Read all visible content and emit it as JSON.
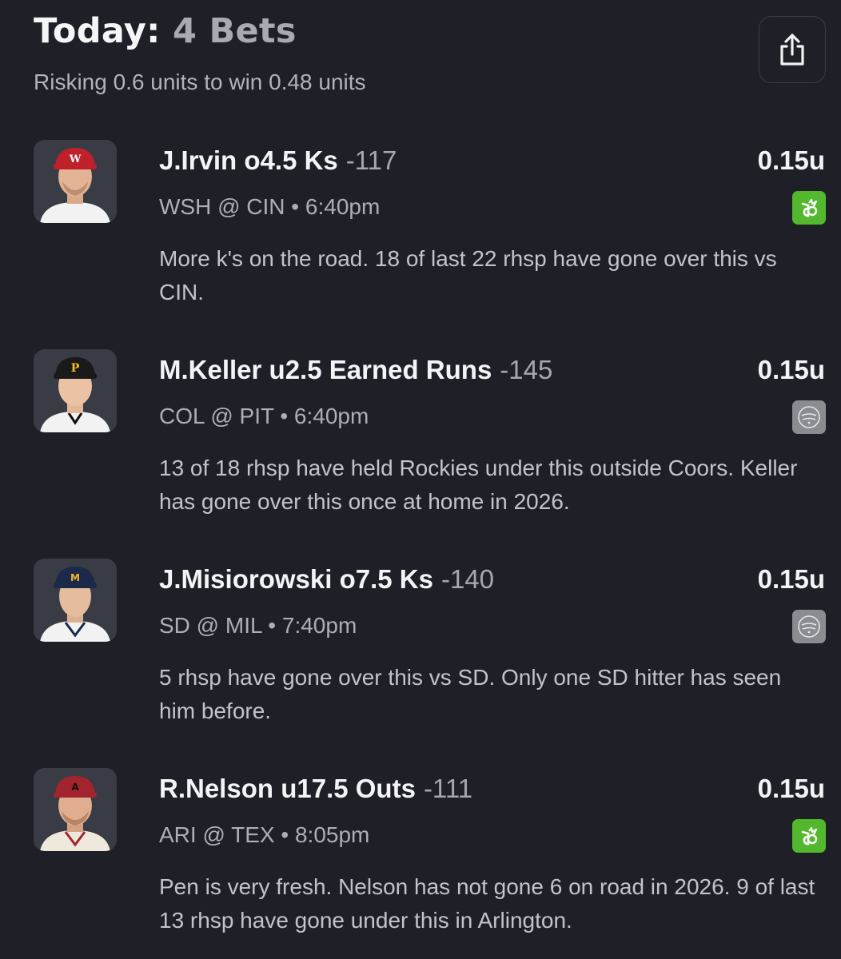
{
  "header": {
    "title_prefix": "Today:",
    "title_count": "4 Bets",
    "subtitle": "Risking 0.6 units to win 0.48 units",
    "share_icon": "share-icon"
  },
  "bets": [
    {
      "player": "J.Irvin",
      "market": "o4.5 Ks",
      "odds": "-117",
      "units": "0.15u",
      "matchup": "WSH @ CIN • 6:40pm",
      "book": "draftkings-icon",
      "note": "More k's on the road. 18 of last 22 rhsp have gone over this vs CIN.",
      "cap_color": "#c0202a",
      "jersey_color": "#f2f2f2"
    },
    {
      "player": "M.Keller",
      "market": "u2.5 Earned Runs",
      "odds": "-145",
      "units": "0.15u",
      "matchup": "COL @ PIT • 6:40pm",
      "book": "hard-rock-icon",
      "note": "13 of 18 rhsp have held Rockies under this outside Coors. Keller has gone over this once at home in 2026.",
      "cap_color": "#1a1a1a",
      "jersey_color": "#f2f2f2"
    },
    {
      "player": "J.Misiorowski",
      "market": "o7.5 Ks",
      "odds": "-140",
      "units": "0.15u",
      "matchup": "SD @ MIL • 7:40pm",
      "book": "hard-rock-icon",
      "note": "5 rhsp have gone over this vs SD. Only one SD hitter has seen him before.",
      "cap_color": "#1b2a4a",
      "jersey_color": "#f2f2f2"
    },
    {
      "player": "R.Nelson",
      "market": "u17.5 Outs",
      "odds": "-111",
      "units": "0.15u",
      "matchup": "ARI @ TEX • 8:05pm",
      "book": "draftkings-icon",
      "note": "Pen is very fresh. Nelson has not gone 6 on road in 2026. 9 of last 13 rhsp have gone under this in Arlington.",
      "cap_color": "#a3242f",
      "jersey_color": "#efe8dc"
    }
  ]
}
